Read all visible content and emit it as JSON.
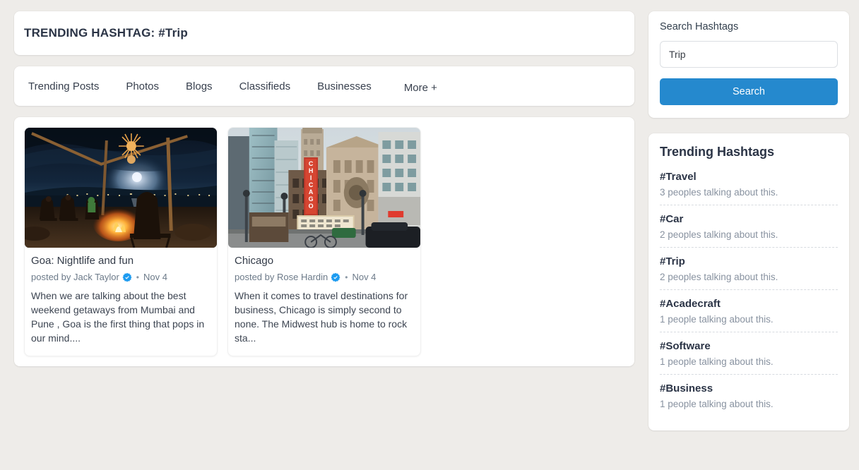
{
  "header": {
    "title": "TRENDING HASHTAG: #Trip"
  },
  "tabs": [
    {
      "label": "Trending Posts"
    },
    {
      "label": "Photos"
    },
    {
      "label": "Blogs"
    },
    {
      "label": "Classifieds"
    },
    {
      "label": "Businesses"
    },
    {
      "label": "More +"
    }
  ],
  "posts": [
    {
      "title": "Goa: Nightlife and fun",
      "posted_by": "posted by Jack Taylor",
      "verified": true,
      "date": "Nov 4",
      "excerpt": "When we are talking about the best weekend getaways from Mumbai and Pune , Goa is the first thing that pops in our mind....",
      "image_alt": "beach-bonfire-night-photo"
    },
    {
      "title": "Chicago",
      "posted_by": "posted by Rose Hardin",
      "verified": true,
      "date": "Nov 4",
      "excerpt": "When it comes to travel destinations for business, Chicago is simply second to none. The Midwest hub is home to rock sta...",
      "image_alt": "chicago-theatre-street-photo"
    }
  ],
  "search": {
    "label": "Search Hashtags",
    "value": "Trip",
    "placeholder": "Search Hashtags",
    "button_label": "Search"
  },
  "trending": {
    "title": "Trending Hashtags",
    "items": [
      {
        "tag": "#Travel",
        "count": "3 peoples talking about this."
      },
      {
        "tag": "#Car",
        "count": "2 peoples talking about this."
      },
      {
        "tag": "#Trip",
        "count": "2 peoples talking about this."
      },
      {
        "tag": "#Acadecraft",
        "count": "1 people talking about this."
      },
      {
        "tag": "#Software",
        "count": "1 people talking about this."
      },
      {
        "tag": "#Business",
        "count": "1 people talking about this."
      }
    ]
  },
  "colors": {
    "accent": "#2589ce",
    "verified_badge": "#1d9bf0",
    "page_bg": "#eeece9",
    "heading": "#2b3446",
    "muted": "#8892a0"
  },
  "separator": "•"
}
